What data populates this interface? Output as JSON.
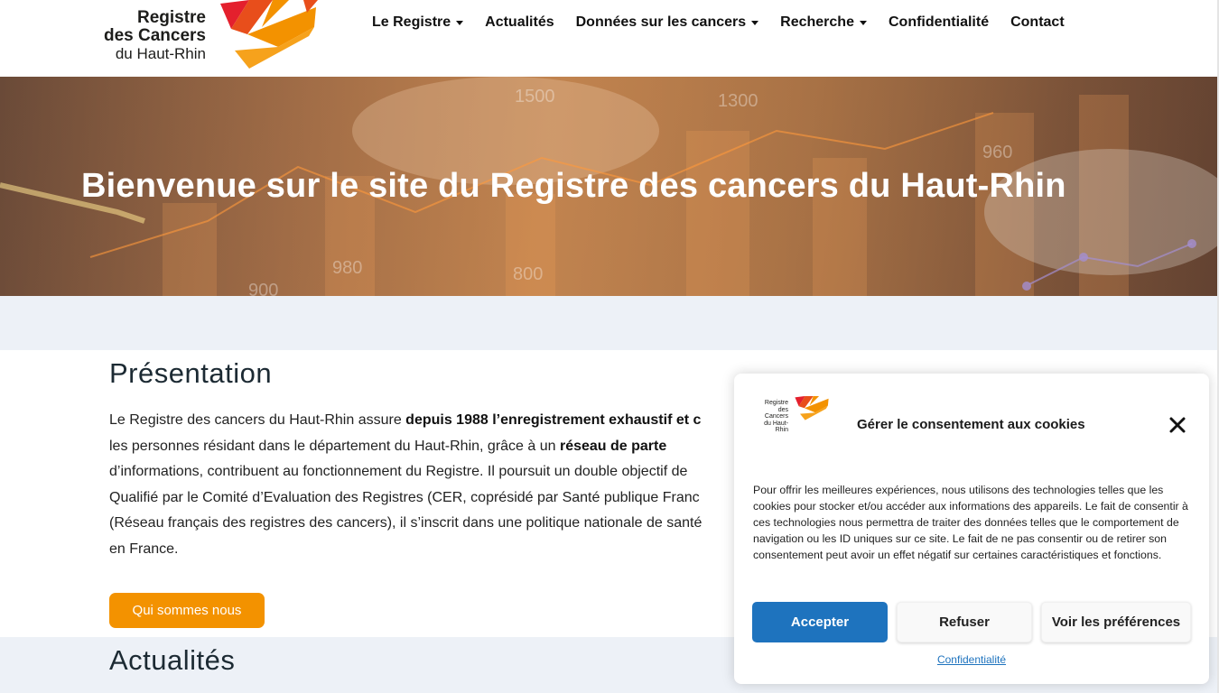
{
  "site": {
    "logo_lines": [
      "Registre",
      "des Cancers",
      "du Haut-Rhin"
    ],
    "brand_colors": {
      "red": "#e4202d",
      "orange": "#f39200",
      "yellow": "#f6b71b"
    }
  },
  "nav": {
    "items": [
      {
        "label": "Le Registre",
        "dropdown": true
      },
      {
        "label": "Actualités",
        "dropdown": false
      },
      {
        "label": "Données sur les cancers",
        "dropdown": true
      },
      {
        "label": "Recherche",
        "dropdown": true
      },
      {
        "label": "Confidentialité",
        "dropdown": false
      },
      {
        "label": "Contact",
        "dropdown": false
      }
    ]
  },
  "hero": {
    "title": "Bienvenue sur le site du Registre des cancers du Haut-Rhin",
    "bg_numbers": [
      "1500",
      "1300",
      "960",
      "980",
      "800",
      "900"
    ]
  },
  "presentation": {
    "title": "Présentation",
    "lines": [
      {
        "pre": "Le Registre des cancers du Haut-Rhin assure ",
        "bold": "depuis 1988 l’enregistrement exhaustif et c",
        "post": ""
      },
      {
        "pre": "les personnes résidant dans le département du Haut-Rhin, grâce à un ",
        "bold": "réseau de parte",
        "post": ""
      },
      {
        "pre": "d’informations, contribuent au fonctionnement du Registre. Il poursuit un double objectif de",
        "bold": "",
        "post": ""
      },
      {
        "pre": "Qualifié par le Comité d’Evaluation des Registres (CER, coprésidé par Santé publique Franc",
        "bold": "",
        "post": ""
      },
      {
        "pre": "(Réseau français des registres des cancers), il s’inscrit dans une politique nationale de santé",
        "bold": "",
        "post": ""
      },
      {
        "pre": "en France.",
        "bold": "",
        "post": ""
      }
    ],
    "button": "Qui sommes nous"
  },
  "actualites": {
    "title": "Actualités"
  },
  "cookie_modal": {
    "title": "Gérer le consentement aux cookies",
    "logo_lines": [
      "Registre",
      "des Cancers",
      "du Haut-Rhin"
    ],
    "text": "Pour offrir les meilleures expériences, nous utilisons des technologies telles que les cookies pour stocker et/ou accéder aux informations des appareils. Le fait de consentir à ces technologies nous permettra de traiter des données telles que le comportement de navigation ou les ID uniques sur ce site. Le fait de ne pas consentir ou de retirer son consentement peut avoir un effet négatif sur certaines caractéristiques et fonctions.",
    "accept": "Accepter",
    "refuse": "Refuser",
    "preferences": "Voir les préférences",
    "link": "Confidentialité"
  }
}
